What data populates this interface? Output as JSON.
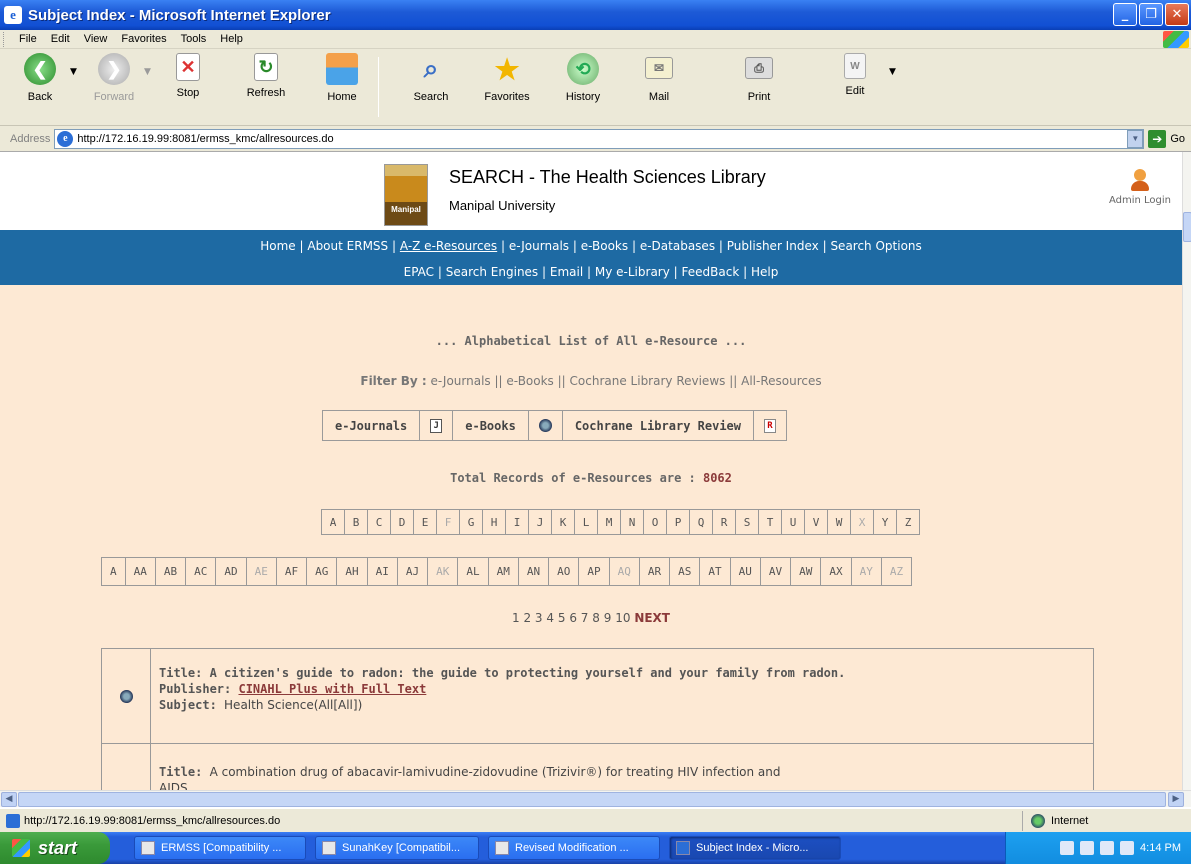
{
  "window": {
    "title": "Subject Index - Microsoft Internet Explorer"
  },
  "menubar": {
    "items": [
      "File",
      "Edit",
      "View",
      "Favorites",
      "Tools",
      "Help"
    ]
  },
  "toolbar": {
    "back": "Back",
    "forward": "Forward",
    "stop": "Stop",
    "refresh": "Refresh",
    "home": "Home",
    "search": "Search",
    "favorites": "Favorites",
    "history": "History",
    "mail": "Mail",
    "print": "Print",
    "edit": "Edit"
  },
  "address": {
    "label": "Address",
    "url": "http://172.16.19.99:8081/ermss_kmc/allresources.do",
    "go": "Go"
  },
  "header": {
    "title": "SEARCH - The Health Sciences Library",
    "subtitle": "Manipal University",
    "logo_text": "Manipal",
    "admin": "Admin Login"
  },
  "nav": {
    "line1": [
      "Home",
      "About ERMSS",
      "A-Z e-Resources",
      "e-Journals",
      "e-Books",
      "e-Databases",
      "Publisher Index",
      "Search Options"
    ],
    "line2": [
      "EPAC",
      "Search Engines",
      "Email",
      "My e-Library",
      "FeedBack",
      "Help"
    ]
  },
  "content": {
    "heading": "... Alphabetical List of All e-Resource ...",
    "filter_label": "Filter By :",
    "filter_items": [
      "e-Journals",
      "e-Books",
      "Cochrane Library Reviews",
      "All-Resources"
    ],
    "types": [
      "e-Journals",
      "e-Books",
      "Cochrane Library Review"
    ],
    "total_label": "Total Records of e-Resources are :",
    "total_value": "8062",
    "letters": [
      "A",
      "B",
      "C",
      "D",
      "E",
      "F",
      "G",
      "H",
      "I",
      "J",
      "K",
      "L",
      "M",
      "N",
      "O",
      "P",
      "Q",
      "R",
      "S",
      "T",
      "U",
      "V",
      "W",
      "X",
      "Y",
      "Z"
    ],
    "sub_letters": [
      "A",
      "AA",
      "AB",
      "AC",
      "AD",
      "AE",
      "AF",
      "AG",
      "AH",
      "AI",
      "AJ",
      "AK",
      "AL",
      "AM",
      "AN",
      "AO",
      "AP",
      "AQ",
      "AR",
      "AS",
      "AT",
      "AU",
      "AV",
      "AW",
      "AX",
      "AY",
      "AZ"
    ],
    "pages": [
      "1",
      "2",
      "3",
      "4",
      "5",
      "6",
      "7",
      "8",
      "9",
      "10"
    ],
    "next": "NEXT",
    "results": [
      {
        "title_label": "Title:",
        "title": "A citizen's guide to radon: the guide to protecting yourself and your family from radon.",
        "publisher_label": "Publisher:",
        "publisher": "CINAHL Plus with Full Text",
        "subject_label": "Subject:",
        "subject": "Health Science(All[All])"
      },
      {
        "title_label": "Title:",
        "title": "A combination drug of abacavir-lamivudine-zidovudine (Trizivir®) for treating HIV infection and",
        "title2": "AIDS"
      }
    ]
  },
  "status": {
    "url": "http://172.16.19.99:8081/ermss_kmc/allresources.do",
    "zone": "Internet"
  },
  "taskbar": {
    "start": "start",
    "tasks": [
      "ERMSS [Compatibility ...",
      "SunahKey [Compatibil...",
      "Revised Modification ...",
      "Subject Index - Micro..."
    ],
    "time": "4:14 PM"
  }
}
